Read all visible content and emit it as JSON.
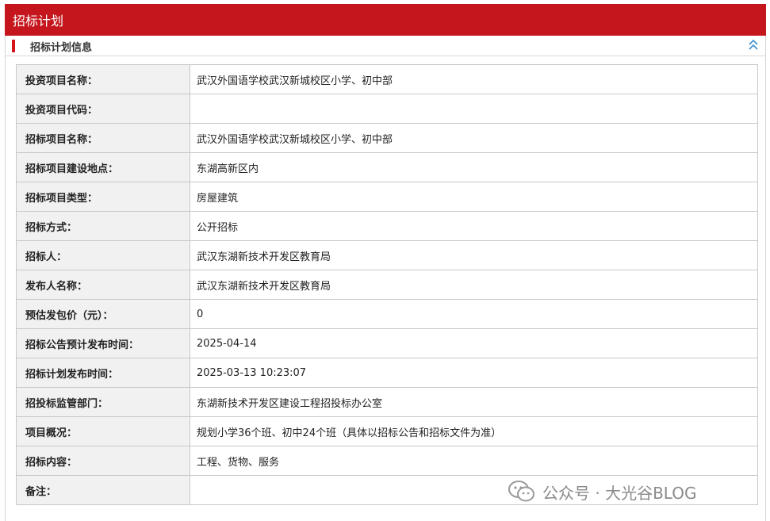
{
  "header": {
    "title": "招标计划"
  },
  "section": {
    "title": "招标计划信息",
    "collapse_icon": "double-chevron-up-icon"
  },
  "rows": [
    {
      "label": "投资项目名称：",
      "value": "武汉外国语学校武汉新城校区小学、初中部"
    },
    {
      "label": "投资项目代码：",
      "value": ""
    },
    {
      "label": "招标项目名称：",
      "value": "武汉外国语学校武汉新城校区小学、初中部"
    },
    {
      "label": "招标项目建设地点：",
      "value": "东湖高新区内"
    },
    {
      "label": "招标项目类型：",
      "value": "房屋建筑"
    },
    {
      "label": "招标方式：",
      "value": "公开招标"
    },
    {
      "label": "招标人：",
      "value": "武汉东湖新技术开发区教育局"
    },
    {
      "label": "发布人名称：",
      "value": "武汉东湖新技术开发区教育局"
    },
    {
      "label": "预估发包价（元）：",
      "value": "0"
    },
    {
      "label": "招标公告预计发布时间：",
      "value": "2025-04-14"
    },
    {
      "label": "招标计划发布时间：",
      "value": "2025-03-13 10:23:07"
    },
    {
      "label": "招投标监管部门：",
      "value": "东湖新技术开发区建设工程招投标办公室"
    },
    {
      "label": "项目概况：",
      "value": "规划小学36个班、初中24个班（具体以招标公告和招标文件为准）"
    },
    {
      "label": "招标内容：",
      "value": "工程、货物、服务"
    },
    {
      "label": "备注：",
      "value": ""
    }
  ],
  "watermark": {
    "text": "公众号 · 大光谷BLOG",
    "icon": "wechat-icon"
  },
  "colors": {
    "accent": "#c4161c",
    "label_bg": "#f1f1f1",
    "border": "#c8c8c8"
  }
}
